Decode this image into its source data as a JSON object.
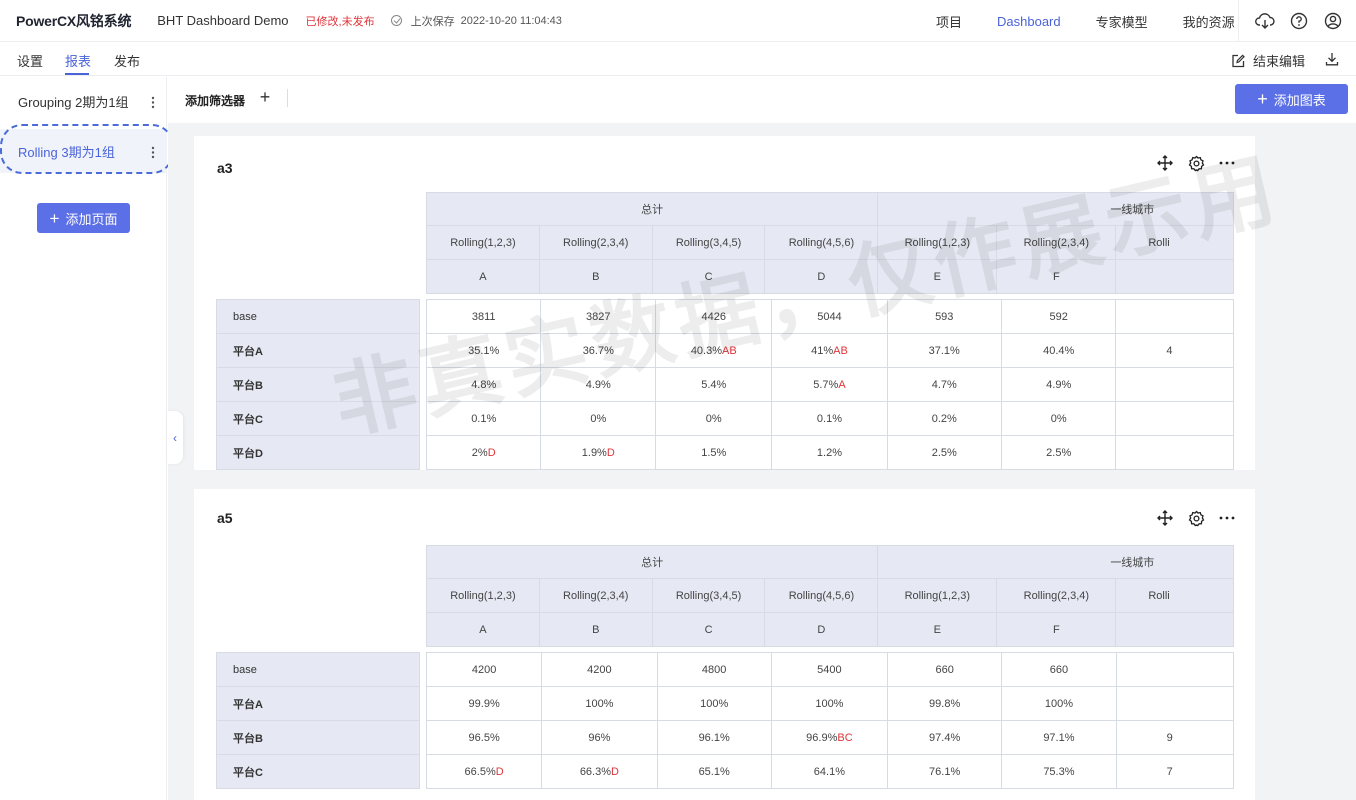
{
  "header": {
    "logo": "PowerCX风铭系统",
    "project_title": "BHT Dashboard Demo",
    "status": "已修改,未发布",
    "save_label": "上次保存",
    "save_time": "2022-10-20 11:04:43",
    "nav": [
      {
        "label": "项目",
        "active": false
      },
      {
        "label": "Dashboard",
        "active": true
      },
      {
        "label": "专家模型",
        "active": false
      },
      {
        "label": "我的资源",
        "active": false
      }
    ],
    "accent_color": "#4a63d8"
  },
  "tabs": [
    {
      "label": "设置",
      "active": false
    },
    {
      "label": "报表",
      "active": true
    },
    {
      "label": "发布",
      "active": false
    }
  ],
  "toolbar": {
    "end_edit": "结束编辑",
    "filter_label": "添加筛选器",
    "add_chart": "添加图表"
  },
  "sidebar": {
    "pages": [
      {
        "label": "Grouping 2期为1组",
        "active": false
      },
      {
        "label": "Rolling 3期为1组",
        "active": true
      }
    ],
    "add_page": "添加页面"
  },
  "watermark": "非真实数据，仅作展示用",
  "cards": [
    {
      "title": "a3",
      "group_headers": [
        "总计",
        "一线城市"
      ],
      "col_headers": [
        "Rolling(1,2,3)",
        "Rolling(2,3,4)",
        "Rolling(3,4,5)",
        "Rolling(4,5,6)",
        "Rolling(1,2,3)",
        "Rolling(2,3,4)",
        "Rolli"
      ],
      "col_letters": [
        "A",
        "B",
        "C",
        "D",
        "E",
        "F",
        ""
      ],
      "row_labels": [
        "base",
        "平台A",
        "平台B",
        "平台C",
        "平台D"
      ],
      "rows": [
        [
          {
            "v": "3811",
            "s": ""
          },
          {
            "v": "3827",
            "s": ""
          },
          {
            "v": "4426",
            "s": ""
          },
          {
            "v": "5044",
            "s": ""
          },
          {
            "v": "593",
            "s": ""
          },
          {
            "v": "592",
            "s": ""
          },
          {
            "v": "",
            "s": ""
          }
        ],
        [
          {
            "v": "35.1%",
            "s": ""
          },
          {
            "v": "36.7%",
            "s": ""
          },
          {
            "v": "40.3%",
            "s": "AB"
          },
          {
            "v": "41%",
            "s": "AB"
          },
          {
            "v": "37.1%",
            "s": ""
          },
          {
            "v": "40.4%",
            "s": ""
          },
          {
            "v": "4",
            "s": ""
          }
        ],
        [
          {
            "v": "4.8%",
            "s": ""
          },
          {
            "v": "4.9%",
            "s": ""
          },
          {
            "v": "5.4%",
            "s": ""
          },
          {
            "v": "5.7%",
            "s": "A"
          },
          {
            "v": "4.7%",
            "s": ""
          },
          {
            "v": "4.9%",
            "s": ""
          },
          {
            "v": "",
            "s": ""
          }
        ],
        [
          {
            "v": "0.1%",
            "s": ""
          },
          {
            "v": "0%",
            "s": ""
          },
          {
            "v": "0%",
            "s": ""
          },
          {
            "v": "0.1%",
            "s": ""
          },
          {
            "v": "0.2%",
            "s": ""
          },
          {
            "v": "0%",
            "s": ""
          },
          {
            "v": "",
            "s": ""
          }
        ],
        [
          {
            "v": "2%",
            "s": "D"
          },
          {
            "v": "1.9%",
            "s": "D"
          },
          {
            "v": "1.5%",
            "s": ""
          },
          {
            "v": "1.2%",
            "s": ""
          },
          {
            "v": "2.5%",
            "s": ""
          },
          {
            "v": "2.5%",
            "s": ""
          },
          {
            "v": "",
            "s": ""
          }
        ]
      ]
    },
    {
      "title": "a5",
      "group_headers": [
        "总计",
        "一线城市"
      ],
      "col_headers": [
        "Rolling(1,2,3)",
        "Rolling(2,3,4)",
        "Rolling(3,4,5)",
        "Rolling(4,5,6)",
        "Rolling(1,2,3)",
        "Rolling(2,3,4)",
        "Rolli"
      ],
      "col_letters": [
        "A",
        "B",
        "C",
        "D",
        "E",
        "F",
        ""
      ],
      "row_labels": [
        "base",
        "平台A",
        "平台B",
        "平台C"
      ],
      "rows": [
        [
          {
            "v": "4200",
            "s": ""
          },
          {
            "v": "4200",
            "s": ""
          },
          {
            "v": "4800",
            "s": ""
          },
          {
            "v": "5400",
            "s": ""
          },
          {
            "v": "660",
            "s": ""
          },
          {
            "v": "660",
            "s": ""
          },
          {
            "v": "",
            "s": ""
          }
        ],
        [
          {
            "v": "99.9%",
            "s": ""
          },
          {
            "v": "100%",
            "s": ""
          },
          {
            "v": "100%",
            "s": ""
          },
          {
            "v": "100%",
            "s": ""
          },
          {
            "v": "99.8%",
            "s": ""
          },
          {
            "v": "100%",
            "s": ""
          },
          {
            "v": "",
            "s": ""
          }
        ],
        [
          {
            "v": "96.5%",
            "s": ""
          },
          {
            "v": "96%",
            "s": ""
          },
          {
            "v": "96.1%",
            "s": ""
          },
          {
            "v": "96.9%",
            "s": "BC"
          },
          {
            "v": "97.4%",
            "s": ""
          },
          {
            "v": "97.1%",
            "s": ""
          },
          {
            "v": "9",
            "s": ""
          }
        ],
        [
          {
            "v": "66.5%",
            "s": "D"
          },
          {
            "v": "66.3%",
            "s": "D"
          },
          {
            "v": "65.1%",
            "s": ""
          },
          {
            "v": "64.1%",
            "s": ""
          },
          {
            "v": "76.1%",
            "s": ""
          },
          {
            "v": "75.3%",
            "s": ""
          },
          {
            "v": "7",
            "s": ""
          }
        ]
      ]
    }
  ]
}
